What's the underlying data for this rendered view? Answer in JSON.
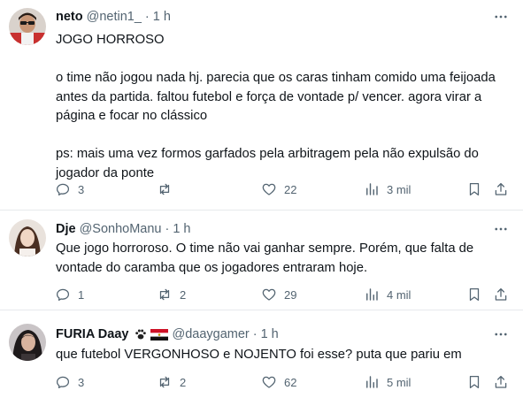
{
  "tweets": [
    {
      "name": "neto",
      "handle": "@netin1_",
      "dot": "·",
      "time": "1 h",
      "body_lines": [
        "JOGO HORROSO",
        "",
        "o time não jogou nada hj. parecia que os caras tinham comido uma feijoada",
        "antes da partida. faltou futebol e força de vontade p/ vencer. agora virar a",
        "página e focar no clássico",
        "",
        "ps: mais uma vez formos garfados pela arbitragem pela não expulsão do",
        "jogador da ponte"
      ],
      "replies": "3",
      "retweets": "",
      "likes": "22",
      "views": "3 mil"
    },
    {
      "name": "Dje",
      "handle": "@SonhoManu",
      "dot": "·",
      "time": "1 h",
      "body_lines": [
        "Que jogo horroroso. O time não vai ganhar sempre. Porém, que falta de",
        "vontade do caramba que os jogadores entraram hoje."
      ],
      "replies": "1",
      "retweets": "2",
      "likes": "29",
      "views": "4 mil"
    },
    {
      "name": "FURIA Daay",
      "handle": "@daaygamer",
      "dot": "·",
      "time": "1 h",
      "body_lines": [
        "que futebol VERGONHOSO e NOJENTO foi esse? puta que pariu em"
      ],
      "replies": "3",
      "retweets": "2",
      "likes": "62",
      "views": "5 mil"
    }
  ],
  "icons": {
    "reply": "reply-icon",
    "retweet": "retweet-icon",
    "like": "heart-icon",
    "views": "views-icon",
    "bookmark": "bookmark-icon",
    "share": "share-icon",
    "more": "more-icon"
  },
  "colors": {
    "text": "#0f1419",
    "secondary": "#536471",
    "separator": "#e7e9ec"
  }
}
